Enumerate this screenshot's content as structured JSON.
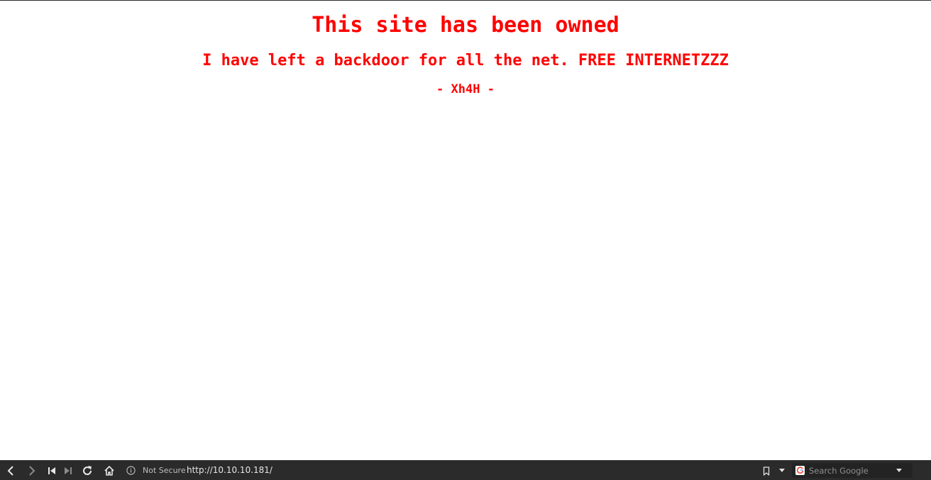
{
  "page": {
    "headline": "This site has been owned",
    "message": "I have left a backdoor for all the net. FREE INTERNETZZZ",
    "signature": "- Xh4H -",
    "text_color": "#ff0000",
    "background_color": "#ffffff"
  },
  "toolbar": {
    "background_color": "#2b2b2b",
    "buttons": [
      {
        "name": "back",
        "icon": "chevron-left-icon"
      },
      {
        "name": "forward",
        "icon": "chevron-right-icon"
      },
      {
        "name": "rewind",
        "icon": "skip-back-icon"
      },
      {
        "name": "fast-forward",
        "icon": "skip-forward-icon"
      },
      {
        "name": "reload",
        "icon": "reload-icon"
      },
      {
        "name": "home",
        "icon": "home-icon"
      }
    ],
    "security_label": "Not Secure",
    "security_icon": "info-icon",
    "url": "http://10.10.10.181/",
    "bookmark_icon": "bookmark-icon",
    "bookmark_menu_icon": "caret-down-icon",
    "search": {
      "engine_icon": "google-g-icon",
      "placeholder": "Search Google",
      "dropdown_icon": "caret-down-icon"
    }
  }
}
